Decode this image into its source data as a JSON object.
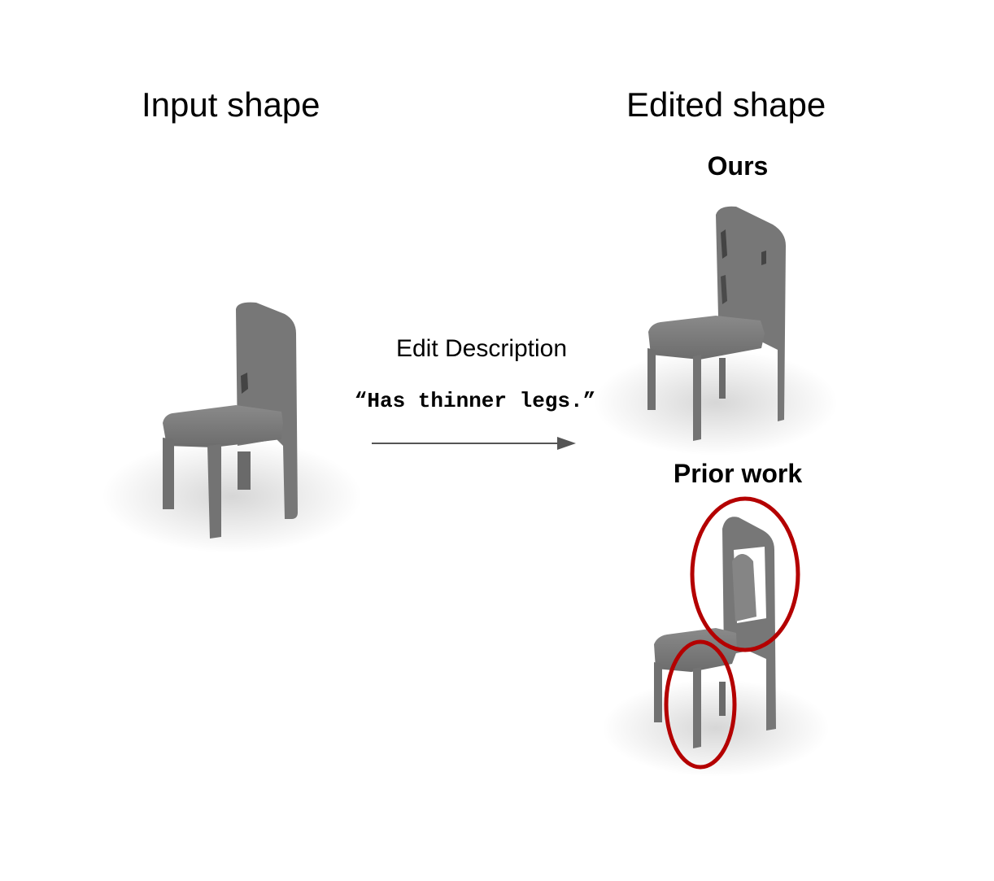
{
  "headers": {
    "input": "Input shape",
    "edited": "Edited shape"
  },
  "methods": {
    "ours": "Ours",
    "prior": "Prior work"
  },
  "edit": {
    "label": "Edit Description",
    "text": "“Has thinner legs.”"
  },
  "colors": {
    "chair_fill": "#7c7c7c",
    "chair_dark": "#555555",
    "highlight": "#b40000",
    "arrow": "#555555"
  }
}
